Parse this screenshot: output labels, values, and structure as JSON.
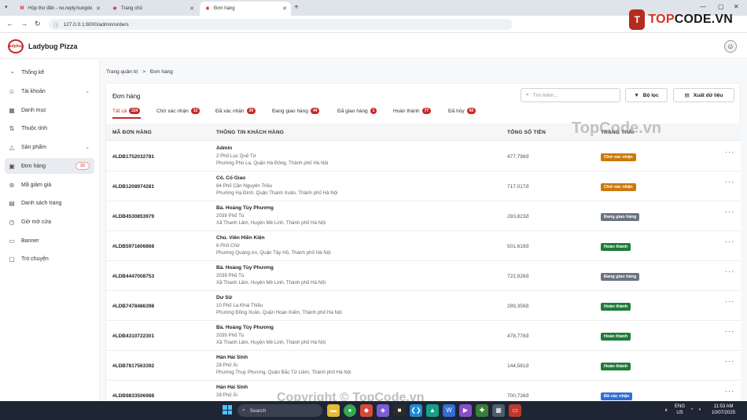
{
  "browser": {
    "tabs": [
      {
        "title": "Hộp thư đến - no.reply.hungdo",
        "icon": "gmail-icon",
        "color": "#d93025"
      },
      {
        "title": "Trang chủ",
        "icon": "pizza-icon",
        "color": "#c62828"
      },
      {
        "title": "Đơn hàng",
        "icon": "pizza-icon",
        "color": "#c62828"
      }
    ],
    "url": "127.0.0.1:8000/admin/orders"
  },
  "overlay_logo": {
    "mark": "T",
    "text_a": "TOP",
    "text_b": "CODE.VN"
  },
  "app": {
    "brand": "Ladybug Pizza",
    "logo_text": "ladybug"
  },
  "sidebar": {
    "items": [
      {
        "label": "Thống kê",
        "icon": "chart-icon"
      },
      {
        "label": "Tài khoản",
        "icon": "user-icon",
        "expandable": true
      },
      {
        "label": "Danh mục",
        "icon": "grid-icon"
      },
      {
        "label": "Thuộc tính",
        "icon": "sliders-icon"
      },
      {
        "label": "Sản phẩm",
        "icon": "triangle-icon",
        "expandable": true
      },
      {
        "label": "Đơn hàng",
        "icon": "box-icon",
        "count": "33",
        "active": true
      },
      {
        "label": "Mã giảm giá",
        "icon": "discount-icon"
      },
      {
        "label": "Danh sách trang",
        "icon": "pages-icon"
      },
      {
        "label": "Giờ mở cửa",
        "icon": "clock-icon"
      },
      {
        "label": "Banner",
        "icon": "image-icon"
      },
      {
        "label": "Trò chuyện",
        "icon": "chat-icon"
      }
    ]
  },
  "breadcrumb": {
    "root": "Trang quản trị",
    "sep": ">",
    "current": "Đơn hàng"
  },
  "page": {
    "title": "Đơn hàng",
    "search_placeholder": "Tìm kiếm...",
    "filter_label": "Bộ lọc",
    "export_label": "Xuất dữ liệu"
  },
  "filter_tabs": [
    {
      "label": "Tất cả",
      "count": "224",
      "active": true
    },
    {
      "label": "Chờ xác nhận",
      "count": "13"
    },
    {
      "label": "Đã xác nhận",
      "count": "39"
    },
    {
      "label": "Đang giao hàng",
      "count": "44"
    },
    {
      "label": "Đã giao hàng",
      "count": "1"
    },
    {
      "label": "Hoàn thành",
      "count": "77"
    },
    {
      "label": "Đã hủy",
      "count": "50"
    }
  ],
  "table": {
    "headers": [
      "MÃ ĐƠN HÀNG",
      "THÔNG TIN KHÁCH HÀNG",
      "TỔNG SỐ TIỀN",
      "TRẠNG THÁI"
    ],
    "rows": [
      {
        "code": "#LDB1752032781",
        "name": "Admin",
        "addr1": "2 Phố Lục Quế Từ",
        "addr2": "Phường Phú La, Quận Hà Đông, Thành phố Hà Nội",
        "total": "477,798đ",
        "status": "Chờ xác nhận",
        "color": "#c9790d"
      },
      {
        "code": "#LDB1208974281",
        "name": "Cô. Cổ Giao",
        "addr1": "84 Phố Cần Nguyên Triều",
        "addr2": "Phường Hạ Đình, Quận Thanh Xuân, Thành phố Hà Nội",
        "total": "717,017đ",
        "status": "Chờ xác nhận",
        "color": "#c9790d"
      },
      {
        "code": "#LDB4530853979",
        "name": "Bà. Hoàng Tùy Phương",
        "addr1": "2039 Phố Tú",
        "addr2": "Xã Thanh Lâm, Huyện Mê Linh, Thành phố Hà Nội",
        "total": "283,823đ",
        "status": "Đang giao hàng",
        "color": "#6b7280"
      },
      {
        "code": "#LDB5971606868",
        "name": "Chú. Viên Hiền Kiện",
        "addr1": "6 Phố Chử",
        "addr2": "Phường Quảng An, Quận Tây Hồ, Thành phố Hà Nội",
        "total": "501,619đ",
        "status": "Hoàn thành",
        "color": "#1f7a3a"
      },
      {
        "code": "#LDB4447008753",
        "name": "Bà. Hoàng Tùy Phương",
        "addr1": "2039 Phố Tú",
        "addr2": "Xã Thanh Lâm, Huyện Mê Linh, Thành phố Hà Nội",
        "total": "722,928đ",
        "status": "Đang giao hàng",
        "color": "#6b7280"
      },
      {
        "code": "#LDB7478486398",
        "name": "Dư Sử",
        "addr1": "10 Phố La Khai Thiều",
        "addr2": "Phường Đồng Xuân, Quận Hoàn Kiếm, Thành phố Hà Nội",
        "total": "289,359đ",
        "status": "Hoàn thành",
        "color": "#1f7a3a"
      },
      {
        "code": "#LDB4310722301",
        "name": "Bà. Hoàng Tùy Phương",
        "addr1": "2039 Phố Tú",
        "addr2": "Xã Thanh Lâm, Huyện Mê Linh, Thành phố Hà Nội",
        "total": "478,778đ",
        "status": "Hoàn thành",
        "color": "#1f7a3a"
      },
      {
        "code": "#LDB7817563392",
        "name": "Hán Hải Sinh",
        "addr1": "28 Phố Ái",
        "addr2": "Phường Thụy Phương, Quận Bắc Từ Liêm, Thành phố Hà Nội",
        "total": "144,581đ",
        "status": "Hoàn thành",
        "color": "#1f7a3a"
      },
      {
        "code": "#LDB9833506988",
        "name": "Hán Hải Sinh",
        "addr1": "28 Phố Ái",
        "addr2": "",
        "total": "700,738đ",
        "status": "Đã xác nhận",
        "color": "#2f6fd6"
      }
    ]
  },
  "watermarks": {
    "top": "TopCode.vn",
    "bottom": "Copyright © TopCode.vn"
  },
  "taskbar": {
    "search_placeholder": "Search",
    "lang_1": "ENG",
    "lang_2": "US",
    "time": "11:53 AM",
    "date": "10/07/2025"
  }
}
